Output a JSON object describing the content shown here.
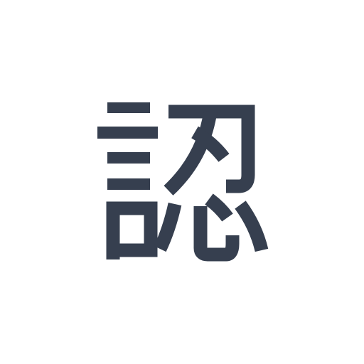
{
  "character": "認",
  "icon": "kanji-character-icon",
  "colors": {
    "glyph": "#363f4f",
    "background": "#ffffff"
  }
}
